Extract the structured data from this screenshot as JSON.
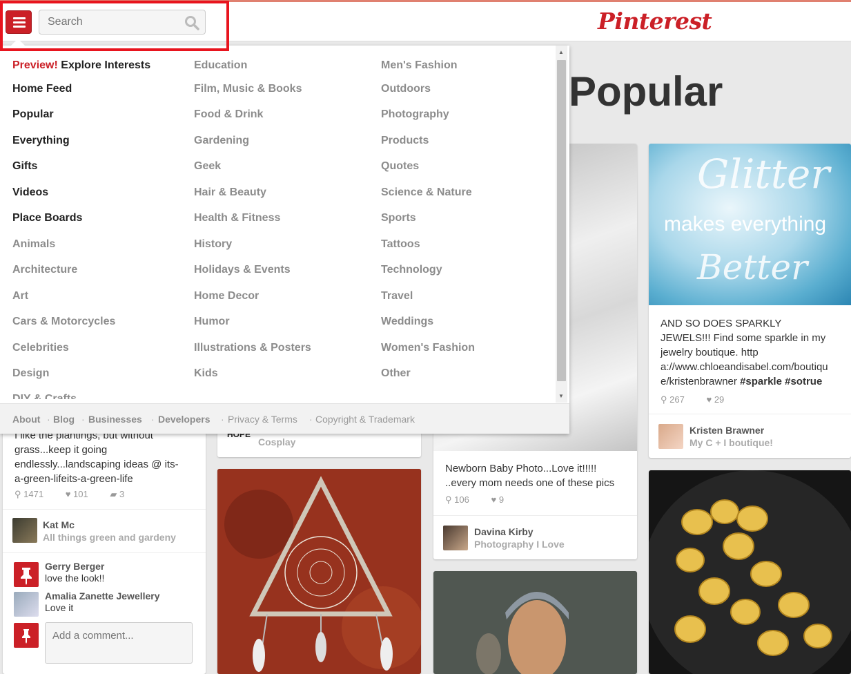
{
  "header": {
    "search_placeholder": "Search",
    "logo": "Pinterest"
  },
  "page": {
    "title": "Popular"
  },
  "menu": {
    "col1": [
      {
        "label": "Explore Interests",
        "prefix": "Preview!",
        "style": "main"
      },
      {
        "label": "Home Feed",
        "style": "main"
      },
      {
        "label": "Popular",
        "style": "main"
      },
      {
        "label": "Everything",
        "style": "main"
      },
      {
        "label": "Gifts",
        "style": "main"
      },
      {
        "label": "Videos",
        "style": "main"
      },
      {
        "label": "Place Boards",
        "style": "main"
      },
      {
        "label": "Animals",
        "style": "cat"
      },
      {
        "label": "Architecture",
        "style": "cat"
      },
      {
        "label": "Art",
        "style": "cat"
      },
      {
        "label": "Cars & Motorcycles",
        "style": "cat"
      },
      {
        "label": "Celebrities",
        "style": "cat"
      },
      {
        "label": "Design",
        "style": "cat"
      },
      {
        "label": "DIY & Crafts",
        "style": "cat"
      }
    ],
    "col2": [
      "Education",
      "Film, Music & Books",
      "Food & Drink",
      "Gardening",
      "Geek",
      "Hair & Beauty",
      "Health & Fitness",
      "History",
      "Holidays & Events",
      "Home Decor",
      "Humor",
      "Illustrations & Posters",
      "Kids"
    ],
    "col3": [
      "Men's Fashion",
      "Outdoors",
      "Photography",
      "Products",
      "Quotes",
      "Science & Nature",
      "Sports",
      "Tattoos",
      "Technology",
      "Travel",
      "Weddings",
      "Women's Fashion",
      "Other"
    ],
    "footer": [
      {
        "label": "About",
        "style": "bold"
      },
      {
        "label": "Blog",
        "style": "bold"
      },
      {
        "label": "Businesses",
        "style": "bold"
      },
      {
        "label": "Developers",
        "style": "bold"
      },
      {
        "label": "Privacy & Terms",
        "style": "plain"
      },
      {
        "label": "Copyright & Trademark",
        "style": "plain"
      }
    ]
  },
  "pins": {
    "garden": {
      "desc_lines": [
        "I like the plantings, but without",
        "grass...keep it going",
        "endlessly...landscaping ideas @ its-",
        "a-green-lifeits-a-green-life"
      ],
      "repins": "1471",
      "likes": "101",
      "comments": "3",
      "user": "Kat Mc",
      "board": "All things green and gardeny",
      "comments_list": [
        {
          "name": "Gerry Berger",
          "text": "love the look!!"
        },
        {
          "name": "Amalia Zanette Jewellery",
          "text": "Love it"
        }
      ],
      "comment_placeholder": "Add a comment..."
    },
    "cosplay": {
      "logo": "HOPE",
      "board": "Cosplay"
    },
    "baby": {
      "desc_lines": [
        "Newborn Baby Photo...Love it!!!!!",
        "..every mom needs one of these pics"
      ],
      "repins": "106",
      "likes": "9",
      "user": "Davina Kirby",
      "board": "Photography I Love"
    },
    "glitter": {
      "image_text": [
        "Glitter",
        "makes everything",
        "Better"
      ],
      "desc_lines": [
        "AND SO DOES SPARKLY",
        "JEWELS!!! Find some sparkle in my",
        "jewelry boutique. http",
        "a://www.chloeandisabel.com/boutiqu"
      ],
      "desc_last": "e/kristenbrawner",
      "hashtags": "#sparkle #sotrue",
      "repins": "267",
      "likes": "29",
      "user": "Kristen Brawner",
      "board": "My C + I boutique!"
    }
  },
  "colors": {
    "brand": "#cb2027",
    "highlight": "#e8141e"
  }
}
